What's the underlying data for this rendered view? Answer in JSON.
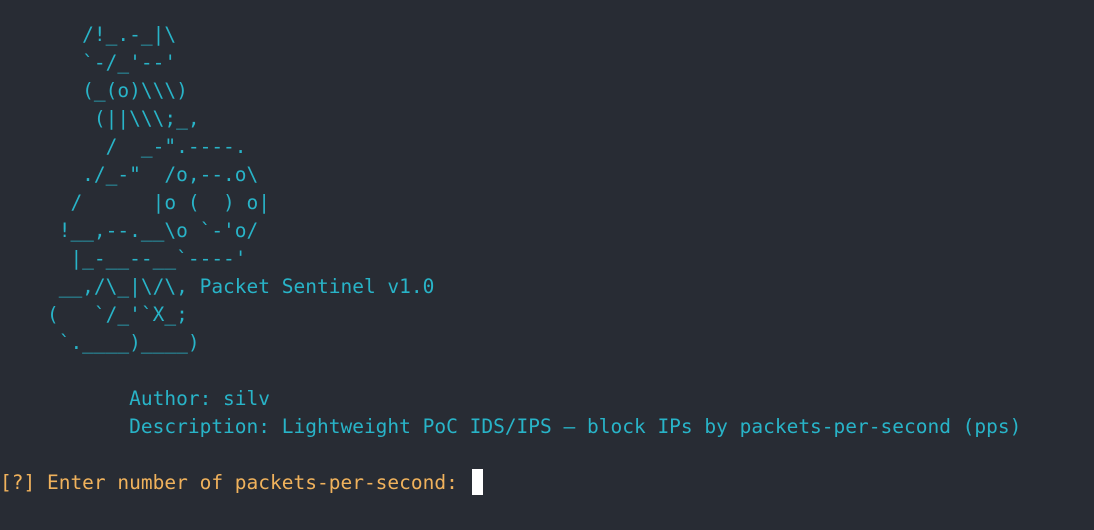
{
  "theme": {
    "background": "#282c34",
    "ascii_color": "#28b4c8",
    "prompt_color": "#f0b25c",
    "cursor_color": "#ffffff"
  },
  "banner": {
    "art": [
      "       /!_.-_|\\",
      "       `-/_'--'",
      "       (_(o)\\\\\\)",
      "        (||\\\\\\;_,",
      "         /  _-\".----.",
      "       ./_-\"  /o,--.o\\",
      "      /      |o (  ) o|",
      "     !__,--.__\\o `-'o/",
      "      |_-__--__`----'",
      "     __,/\\_|\\/\\, Packet Sentinel v1.0",
      "    (   `/_'`X_;",
      "     `.____)____)"
    ]
  },
  "info": {
    "author": "           Author: silv",
    "description": "           Description: Lightweight PoC IDS/IPS — block IPs by packets-per-second (pps)"
  },
  "prompt": {
    "text": "[?] Enter number of packets-per-second: ",
    "input_value": ""
  }
}
